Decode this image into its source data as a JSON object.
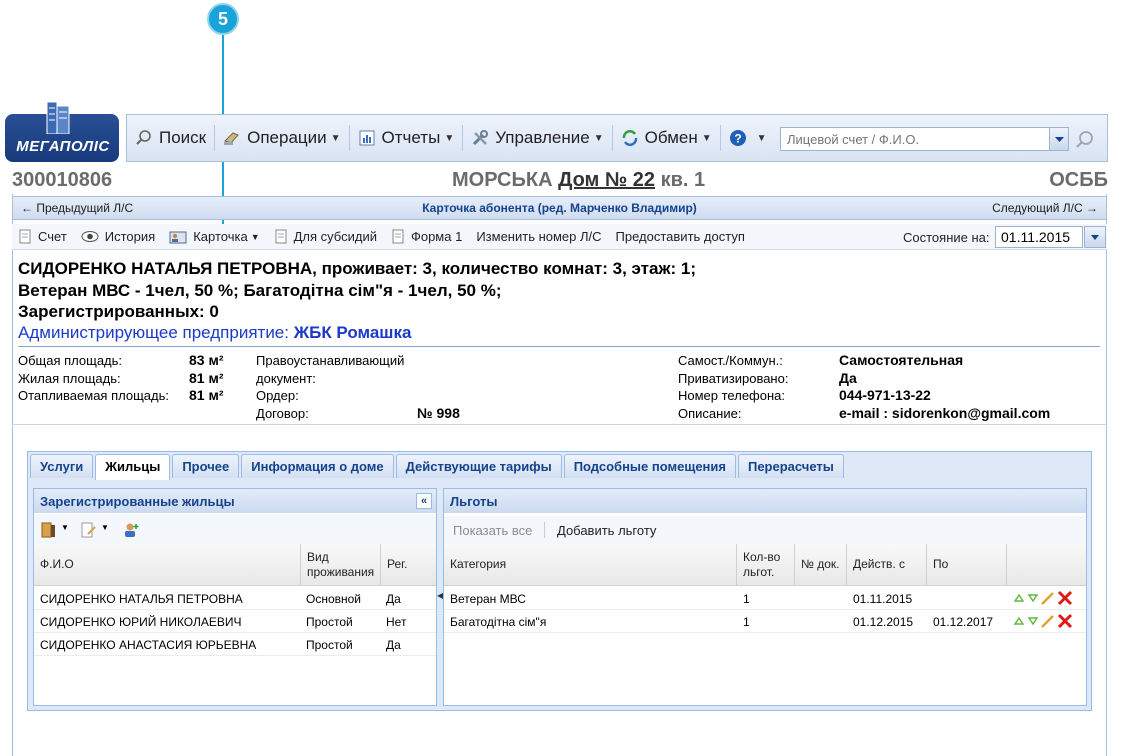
{
  "callout": {
    "number": "5"
  },
  "logo": {
    "text": "МЕГАПОЛІС"
  },
  "toolbar": {
    "search": "Поиск",
    "operations": "Операции",
    "reports": "Отчеты",
    "management": "Управление",
    "exchange": "Обмен",
    "search_placeholder": "Лицевой счет / Ф.И.О."
  },
  "header": {
    "account": "300010806",
    "street": "МОРСЬКА",
    "house": "Дом № 22",
    "apt": "кв. 1",
    "org": "ОСББ"
  },
  "nav": {
    "prev": "← Предыдущий Л/С",
    "title": "Карточка абонента (ред. Марченко Владимир)",
    "next": "Следующий Л/С →"
  },
  "actions": {
    "account": "Счет",
    "history": "История",
    "card": "Карточка",
    "subsidies": "Для субсидий",
    "form1": "Форма 1",
    "change_number": "Изменить номер Л/С",
    "grant_access": "Предоставить доступ",
    "state_label": "Состояние на:",
    "state_date": "01.11.2015"
  },
  "subscriber": {
    "line1": "СИДОРЕНКО НАТАЛЬЯ ПЕТРОВНА, проживает: 3, количество комнат: 3, этаж: 1;",
    "line2": "Ветеран МВС - 1чел, 50 %; Багатодітна сім\"я - 1чел, 50 %;",
    "line3": "Зарегистрированных: 0",
    "admin_label": "Администрирующее предприятие:",
    "admin_value": "ЖБК Ромашка"
  },
  "details": {
    "total_area_label": "Общая площадь:",
    "total_area": "83 м²",
    "living_area_label": "Жилая площадь:",
    "living_area": "81 м²",
    "heated_area_label": "Отапливаемая площадь:",
    "heated_area": "81 м²",
    "title_doc_label_1": "Правоустанавливающий",
    "title_doc_label_2": "документ:",
    "order_label": "Ордер:",
    "contract_label": "Договор:",
    "contract_value": "№ 998",
    "self_label": "Самост./Коммун.:",
    "self_value": "Самостоятельная",
    "privatized_label": "Приватизировано:",
    "privatized_value": "Да",
    "phone_label": "Номер телефона:",
    "phone_value": "044-971-13-22",
    "description_label": "Описание:",
    "description_value": "e-mail : sidorenkon@gmail.com"
  },
  "tabs": [
    {
      "label": "Услуги"
    },
    {
      "label": "Жильцы"
    },
    {
      "label": "Прочее"
    },
    {
      "label": "Информация о доме"
    },
    {
      "label": "Действующие тарифы"
    },
    {
      "label": "Подсобные помещения"
    },
    {
      "label": "Перерасчеты"
    }
  ],
  "residents": {
    "title": "Зарегистрированные жильцы",
    "columns": {
      "name": "Ф.И.О",
      "type": "Вид проживания",
      "reg": "Рег."
    },
    "rows": [
      {
        "name": "СИДОРЕНКО НАТАЛЬЯ ПЕТРОВНА",
        "type": "Основной",
        "reg": "Да"
      },
      {
        "name": "СИДОРЕНКО ЮРИЙ НИКОЛАЕВИЧ",
        "type": "Простой",
        "reg": "Нет"
      },
      {
        "name": "СИДОРЕНКО АНАСТАСИЯ ЮРЬЕВНА",
        "type": "Простой",
        "reg": "Да"
      }
    ]
  },
  "benefits": {
    "title": "Льготы",
    "show_all": "Показать все",
    "add": "Добавить льготу",
    "columns": {
      "category": "Категория",
      "count": "Кол-во льгот.",
      "doc": "№ док.",
      "from": "Действ. с",
      "to": "По"
    },
    "rows": [
      {
        "category": "Ветеран МВС",
        "count": "1",
        "doc": "",
        "from": "01.11.2015",
        "to": ""
      },
      {
        "category": "Багатодітна сім\"я",
        "count": "1",
        "doc": "",
        "from": "01.12.2015",
        "to": "01.12.2017"
      }
    ]
  }
}
